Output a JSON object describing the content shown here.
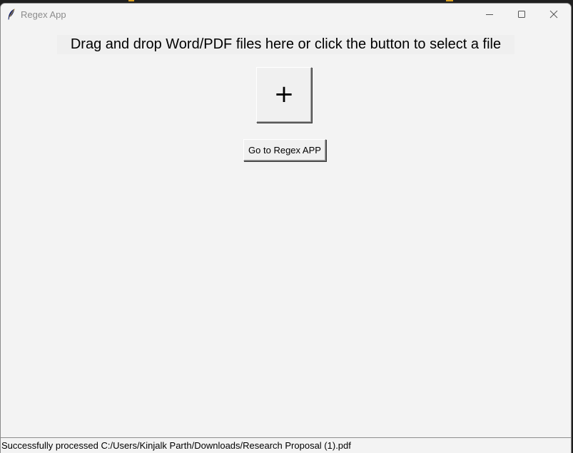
{
  "window": {
    "title": "Regex App",
    "icon": "feather-icon",
    "controls": {
      "minimize_icon": "minimize-icon",
      "maximize_icon": "maximize-icon",
      "close_icon": "close-icon"
    }
  },
  "main": {
    "instruction": "Drag and drop Word/PDF files here or click the button to select a file",
    "select_file_label": "+",
    "goto_label": "Go to Regex APP"
  },
  "status": {
    "message": "Successfully processed C:/Users/Kinjalk Parth/Downloads/Research Proposal (1).pdf"
  },
  "colors": {
    "background": "#f3f3f3",
    "title_text": "#8c8c8c",
    "button_face": "#f0f0f0"
  }
}
